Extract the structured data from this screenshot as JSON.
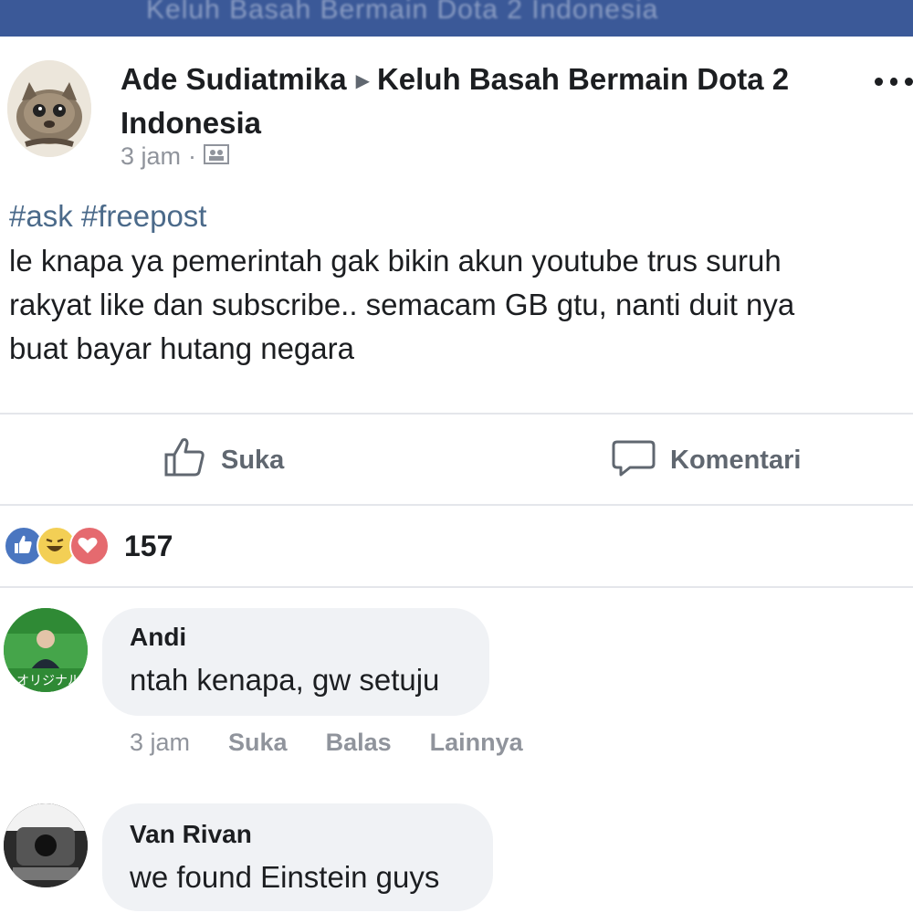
{
  "header": {
    "blurred_title": "Keluh Basah Bermain Dota 2 Indonesia"
  },
  "post": {
    "author": "Ade Sudiatmika",
    "group": "Keluh Basah Bermain Dota 2 Indonesia",
    "time": "3 jam",
    "meta_separator": "·",
    "privacy_icon": "group-icon",
    "hashtags": "#ask #freepost",
    "text_lines": [
      "le knapa ya pemerintah gak bikin akun youtube trus suruh",
      "rakyat like dan subscribe.. semacam GB gtu, nanti duit nya",
      "buat bayar hutang negara"
    ]
  },
  "actions": {
    "like_label": "Suka",
    "comment_label": "Komentari"
  },
  "reactions": {
    "icons": [
      "like-icon",
      "haha-icon",
      "love-icon"
    ],
    "count": "157"
  },
  "comments": [
    {
      "name": "Andi",
      "text": "ntah kenapa, gw setuju",
      "time": "3 jam",
      "like": "Suka",
      "reply": "Balas",
      "more": "Lainnya"
    },
    {
      "name": "Van Rivan",
      "text": "we found Einstein guys"
    }
  ],
  "colors": {
    "facebook_blue": "#3b5998",
    "hashtag": "#4b6a8a",
    "muted": "#90949c",
    "bubble": "#f0f2f5"
  }
}
